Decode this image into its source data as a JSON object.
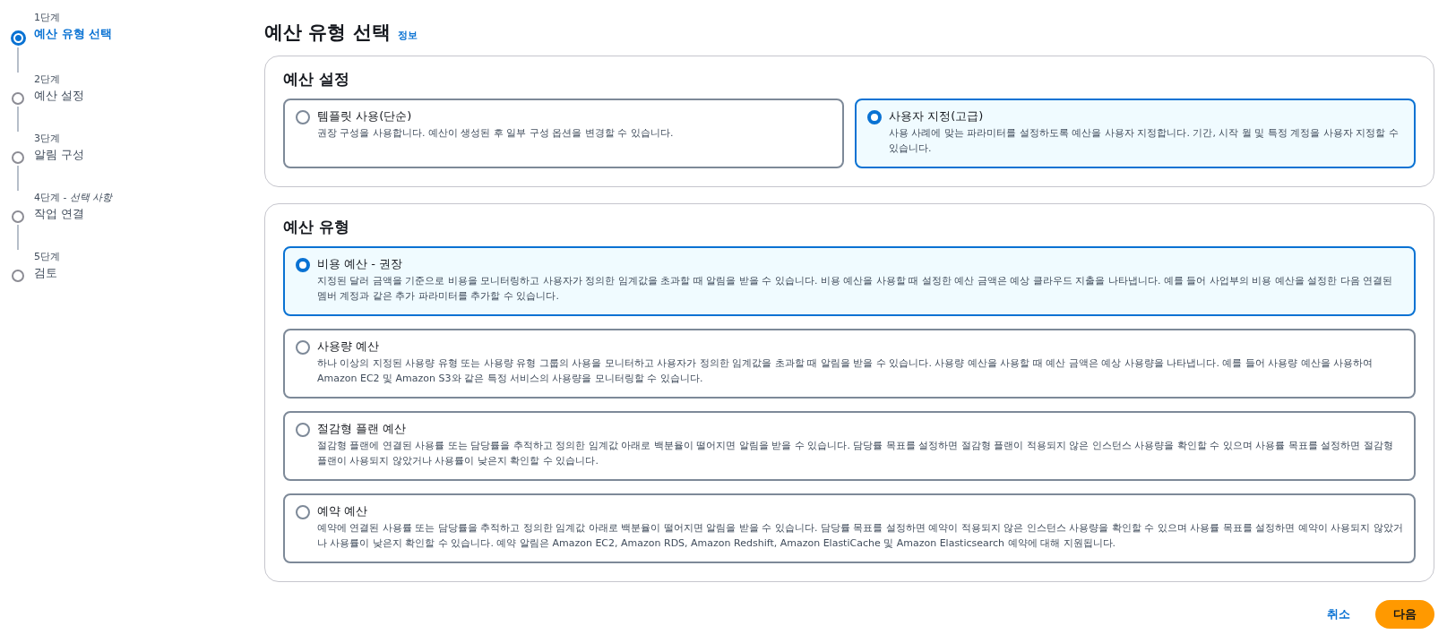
{
  "steps": [
    {
      "step": "1단계",
      "label": "예산 유형 선택",
      "selected": true
    },
    {
      "step": "2단계",
      "label": "예산 설정",
      "selected": false
    },
    {
      "step": "3단계",
      "label": "알림 구성",
      "selected": false
    },
    {
      "step": "4단계 - *선택 사항*",
      "label": "작업 연결",
      "selected": false
    },
    {
      "step": "5단계",
      "label": "검토",
      "selected": false
    }
  ],
  "page_title": "예산 유형 선택",
  "info_link": "정보",
  "setup": {
    "heading": "예산 설정",
    "options": [
      {
        "title": "템플릿 사용(단순)",
        "description": "권장 구성을 사용합니다. 예산이 생성된 후 일부 구성 옵션을 변경할 수 있습니다.",
        "selected": false
      },
      {
        "title": "사용자 지정(고급)",
        "description": "사용 사례에 맞는 파라미터를 설정하도록 예산을 사용자 지정합니다. 기간, 시작 월 및 특정 계정을 사용자 지정할 수 있습니다.",
        "selected": true
      }
    ]
  },
  "budget_type": {
    "heading": "예산 유형",
    "options": [
      {
        "title": "비용 예산 - 권장",
        "description": "지정된 달러 금액을 기준으로 비용을 모니터링하고 사용자가 정의한 임계값을 초과할 때 알림을 받을 수 있습니다. 비용 예산을 사용할 때 설정한 예산 금액은 예상 클라우드 지출을 나타냅니다. 예를 들어 사업부의 비용 예산을 설정한 다음 연결된 멤버 계정과 같은 추가 파라미터를 추가할 수 있습니다.",
        "selected": true
      },
      {
        "title": "사용량 예산",
        "description": "하나 이상의 지정된 사용량 유형 또는 사용량 유형 그룹의 사용을 모니터하고 사용자가 정의한 임계값을 초과할 때 알림을 받을 수 있습니다. 사용량 예산을 사용할 때 예산 금액은 예상 사용량을 나타냅니다. 예를 들어 사용량 예산을 사용하여 Amazon EC2 및 Amazon S3와 같은 특정 서비스의 사용량을 모니터링할 수 있습니다.",
        "selected": false
      },
      {
        "title": "절감형 플랜 예산",
        "description": "절감형 플랜에 연결된 사용률 또는 담당률을 추적하고 정의한 임계값 아래로 백분율이 떨어지면 알림을 받을 수 있습니다. 담당률 목표를 설정하면 절감형 플랜이 적용되지 않은 인스턴스 사용량을 확인할 수 있으며 사용률 목표를 설정하면 절감형 플랜이 사용되지 않았거나 사용률이 낮은지 확인할 수 있습니다.",
        "selected": false
      },
      {
        "title": "예약 예산",
        "description": "예약에 연결된 사용률 또는 담당률을 추적하고 정의한 임계값 아래로 백분율이 떨어지면 알림을 받을 수 있습니다. 담당률 목표를 설정하면 예약이 적용되지 않은 인스턴스 사용량을 확인할 수 있으며 사용률 목표를 설정하면 예약이 사용되지 않았거나 사용률이 낮은지 확인할 수 있습니다. 예약 알림은 Amazon EC2, Amazon RDS, Amazon Redshift, Amazon ElastiCache 및 Amazon Elasticsearch 예약에 대해 지원됩니다.",
        "selected": false
      }
    ]
  },
  "buttons": {
    "cancel": "취소",
    "next": "다음"
  }
}
